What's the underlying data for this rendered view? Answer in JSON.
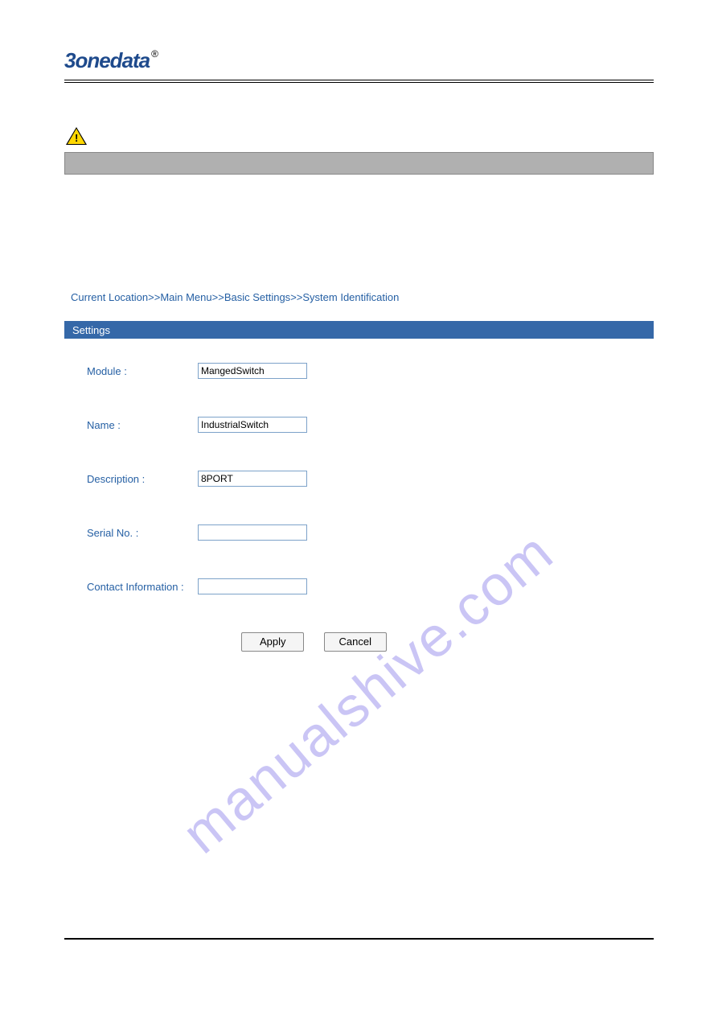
{
  "header": {
    "logo_text": "3onedata",
    "logo_reg": "®"
  },
  "breadcrumb": {
    "current_location": "Current Location",
    "sep": ">>",
    "items": [
      "Main Menu",
      "Basic Settings",
      "System Identification"
    ]
  },
  "section": {
    "title": "Settings"
  },
  "form": {
    "fields": [
      {
        "label": "Module :",
        "value": "MangedSwitch"
      },
      {
        "label": "Name :",
        "value": "IndustrialSwitch"
      },
      {
        "label": "Description :",
        "value": "8PORT"
      },
      {
        "label": "Serial No. :",
        "value": ""
      },
      {
        "label": "Contact Information :",
        "value": ""
      }
    ]
  },
  "buttons": {
    "apply": "Apply",
    "cancel": "Cancel"
  },
  "watermark": "manualshive.com"
}
